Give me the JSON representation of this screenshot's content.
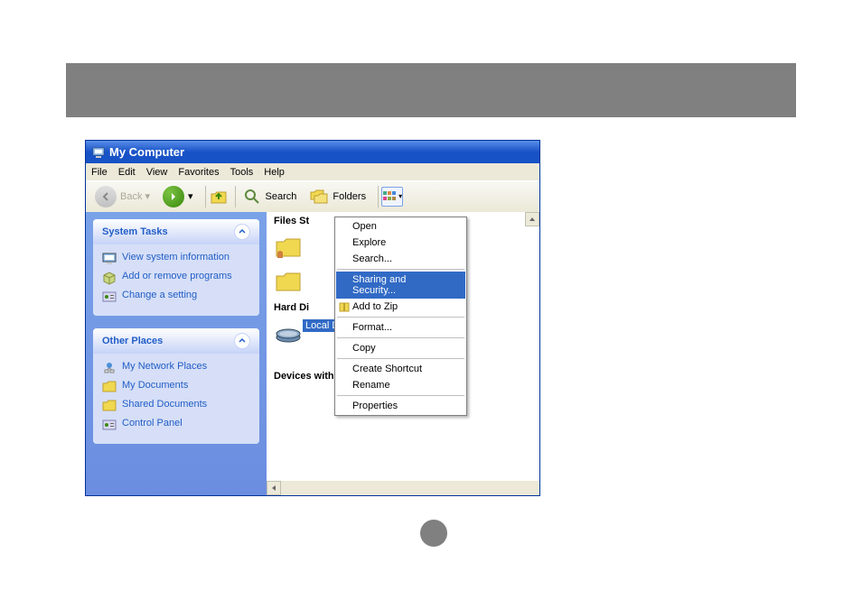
{
  "window": {
    "title": "My Computer"
  },
  "menu": {
    "items": [
      "File",
      "Edit",
      "View",
      "Favorites",
      "Tools",
      "Help"
    ]
  },
  "toolbar": {
    "back": "Back",
    "search": "Search",
    "folders": "Folders"
  },
  "sidebar": {
    "panels": [
      {
        "title": "System Tasks",
        "links": [
          {
            "label": "View system information",
            "name": "view-system-info",
            "icon": "monitor"
          },
          {
            "label": "Add or remove programs",
            "name": "add-remove-programs",
            "icon": "box"
          },
          {
            "label": "Change a setting",
            "name": "change-setting",
            "icon": "control"
          }
        ]
      },
      {
        "title": "Other Places",
        "links": [
          {
            "label": "My Network Places",
            "name": "my-network-places",
            "icon": "network"
          },
          {
            "label": "My Documents",
            "name": "my-documents",
            "icon": "folder"
          },
          {
            "label": "Shared Documents",
            "name": "shared-documents",
            "icon": "folder"
          },
          {
            "label": "Control Panel",
            "name": "control-panel",
            "icon": "control"
          }
        ]
      }
    ]
  },
  "main": {
    "sections": [
      {
        "title": "Files St"
      },
      {
        "title": "Hard Di"
      },
      {
        "title": "Devices with Removable Storage"
      }
    ],
    "local_disk": "Local Disk (C:)"
  },
  "context_menu": {
    "items": [
      {
        "label": "Open",
        "highlighted": false
      },
      {
        "label": "Explore",
        "highlighted": false
      },
      {
        "label": "Search...",
        "highlighted": false
      },
      {
        "sep": true
      },
      {
        "label": "Sharing and Security...",
        "highlighted": true
      },
      {
        "label": "Add to Zip",
        "icon": "zip",
        "highlighted": false
      },
      {
        "sep": true
      },
      {
        "label": "Format...",
        "highlighted": false
      },
      {
        "sep": true
      },
      {
        "label": "Copy",
        "highlighted": false
      },
      {
        "sep": true
      },
      {
        "label": "Create Shortcut",
        "highlighted": false
      },
      {
        "label": "Rename",
        "highlighted": false
      },
      {
        "sep": true
      },
      {
        "label": "Properties",
        "highlighted": false
      }
    ]
  }
}
